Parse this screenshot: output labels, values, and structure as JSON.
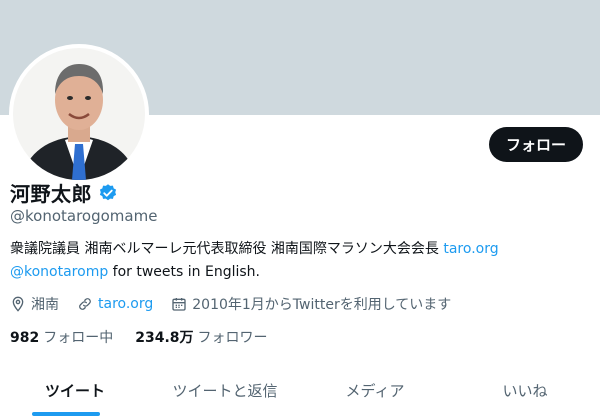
{
  "profile": {
    "name": "河野太郎",
    "handle": "@konotarogomame",
    "follow_label": "フォロー",
    "bio_line1_text": "衆議院議員 湘南ベルマーレ元代表取締役 湘南国際マラソン大会会長 ",
    "bio_line1_link": "taro.org",
    "bio_line2_link": "@konotaromp",
    "bio_line2_text": " for tweets in English.",
    "location": "湘南",
    "website": "taro.org",
    "joined": "2010年1月からTwitterを利用しています",
    "following_count": "982",
    "following_label": "フォロー中",
    "followers_count": "234.8万",
    "followers_label": "フォロワー"
  },
  "tabs": [
    {
      "label": "ツイート"
    },
    {
      "label": "ツイートと返信"
    },
    {
      "label": "メディア"
    },
    {
      "label": "いいね"
    }
  ],
  "colors": {
    "accent": "#1d9bf0",
    "banner": "#cfd9de",
    "text_primary": "#0f1419",
    "text_secondary": "#536471"
  },
  "icons": [
    "verified-badge-icon",
    "location-icon",
    "link-icon",
    "calendar-icon"
  ]
}
